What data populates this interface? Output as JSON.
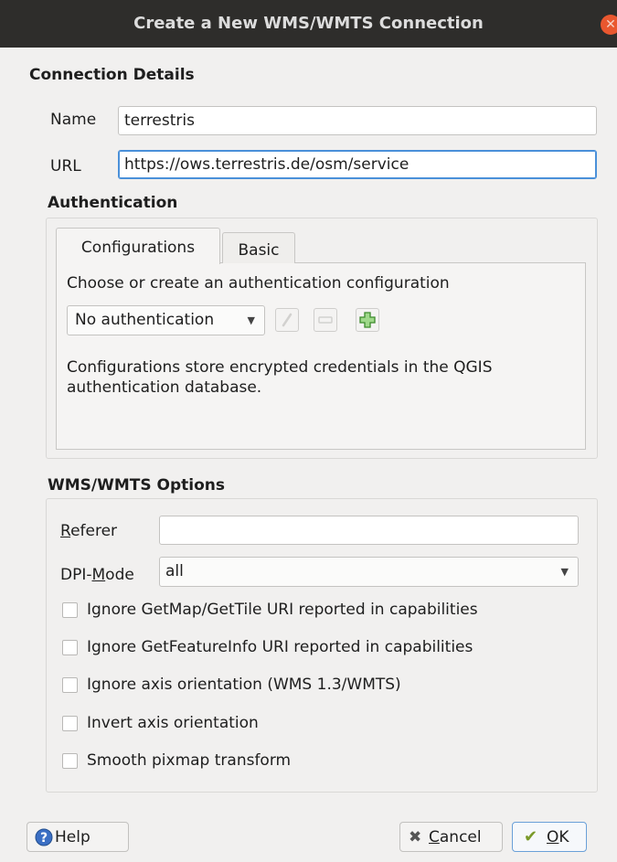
{
  "window": {
    "title": "Create a New WMS/WMTS Connection",
    "close_glyph": "✕"
  },
  "connection": {
    "heading": "Connection Details",
    "name_label": "Name",
    "name_value": "terrestris",
    "url_label": "URL",
    "url_value": "https://ows.terrestris.de/osm/service"
  },
  "auth": {
    "heading": "Authentication",
    "tabs": [
      "Configurations",
      "Basic"
    ],
    "choose_text": "Choose or create an authentication configuration",
    "selected": "No authentication",
    "info_line1": "Configurations store encrypted credentials in the QGIS",
    "info_line2": "authentication database."
  },
  "options": {
    "heading": "WMS/WMTS Options",
    "referer_label_u": "R",
    "referer_label_rest": "eferer",
    "referer_value": "",
    "dpi_label_pre": "DPI-",
    "dpi_label_u": "M",
    "dpi_label_post": "ode",
    "dpi_value": "all",
    "checkboxes": [
      {
        "label": "Ignore GetMap/GetTile URI reported in capabilities",
        "checked": false
      },
      {
        "label": "Ignore GetFeatureInfo URI reported in capabilities",
        "checked": false
      },
      {
        "label": "Ignore axis orientation (WMS 1.3/WMTS)",
        "checked": false
      },
      {
        "label": "Invert axis orientation",
        "checked": false
      },
      {
        "label": "Smooth pixmap transform",
        "checked": false
      }
    ]
  },
  "buttons": {
    "help": "Help",
    "cancel_u": "C",
    "cancel_rest": "ancel",
    "ok_u": "O",
    "ok_rest": "K"
  },
  "colors": {
    "titlebar": "#2e2d2b",
    "close": "#e9572f",
    "focus": "#4a90d9"
  }
}
